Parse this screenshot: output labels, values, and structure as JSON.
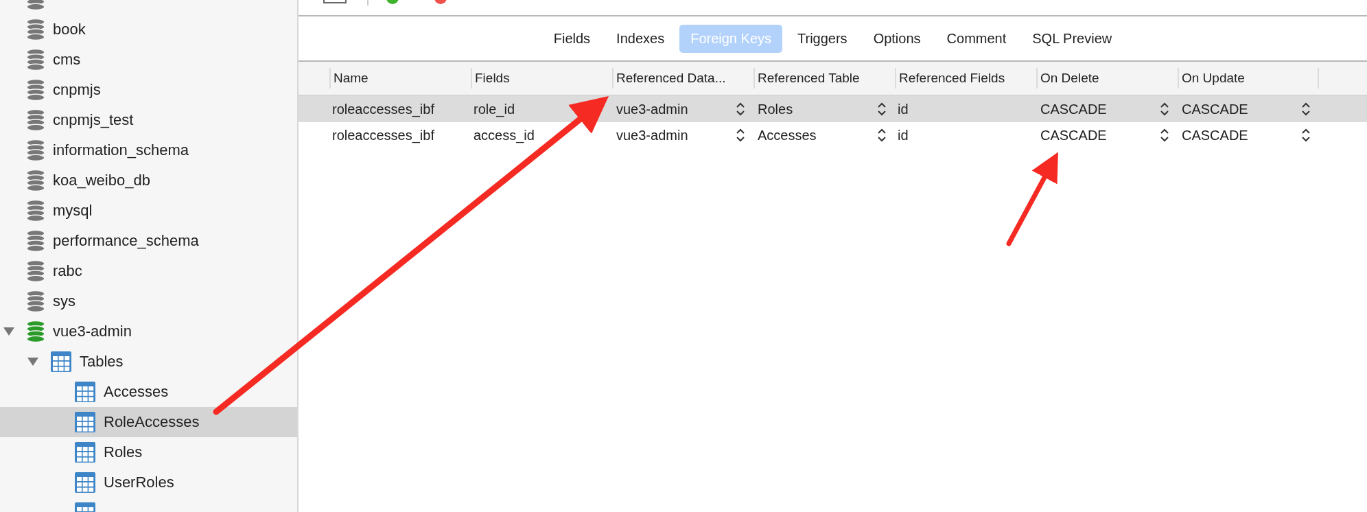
{
  "sidebar": {
    "items": [
      {
        "kind": "database",
        "active": false,
        "selected": false
      },
      {
        "label": "book",
        "kind": "database",
        "active": false,
        "selected": false
      },
      {
        "label": "cms",
        "kind": "database",
        "active": false,
        "selected": false
      },
      {
        "label": "cnpmjs",
        "kind": "database",
        "active": false,
        "selected": false
      },
      {
        "label": "cnpmjs_test",
        "kind": "database",
        "active": false,
        "selected": false
      },
      {
        "label": "information_schema",
        "kind": "database",
        "active": false,
        "selected": false
      },
      {
        "label": "koa_weibo_db",
        "kind": "database",
        "active": false,
        "selected": false
      },
      {
        "label": "mysql",
        "kind": "database",
        "active": false,
        "selected": false
      },
      {
        "label": "performance_schema",
        "kind": "database",
        "active": false,
        "selected": false
      },
      {
        "label": "rabc",
        "kind": "database",
        "active": false,
        "selected": false
      },
      {
        "label": "sys",
        "kind": "database",
        "active": false,
        "selected": false
      },
      {
        "label": "vue3-admin",
        "kind": "database",
        "active": true,
        "selected": false,
        "expanded": true,
        "children": [
          {
            "label": "Tables",
            "kind": "group",
            "selected": false,
            "expanded": true,
            "children": [
              {
                "label": "Accesses",
                "kind": "table",
                "selected": false
              },
              {
                "label": "RoleAccesses",
                "kind": "table",
                "selected": true
              },
              {
                "label": "Roles",
                "kind": "table",
                "selected": false
              },
              {
                "label": "UserRoles",
                "kind": "table",
                "selected": false
              },
              {
                "kind": "table",
                "selected": false
              }
            ]
          }
        ]
      }
    ]
  },
  "tabs": [
    {
      "label": "Fields",
      "selected": false
    },
    {
      "label": "Indexes",
      "selected": false
    },
    {
      "label": "Foreign Keys",
      "selected": true
    },
    {
      "label": "Triggers",
      "selected": false
    },
    {
      "label": "Options",
      "selected": false
    },
    {
      "label": "Comment",
      "selected": false
    },
    {
      "label": "SQL Preview",
      "selected": false
    }
  ],
  "table": {
    "columns": [
      {
        "label": "Name",
        "kind": "text"
      },
      {
        "label": "Fields",
        "kind": "text"
      },
      {
        "label": "Referenced Data...",
        "kind": "popup"
      },
      {
        "label": "Referenced Table",
        "kind": "popup"
      },
      {
        "label": "Referenced Fields",
        "kind": "text"
      },
      {
        "label": "On Delete",
        "kind": "popup"
      },
      {
        "label": "On Update",
        "kind": "popup"
      }
    ],
    "rows": [
      {
        "selected": true,
        "cells": [
          "roleaccesses_ibf",
          "role_id",
          "vue3-admin",
          "Roles",
          "id",
          "CASCADE",
          "CASCADE"
        ]
      },
      {
        "selected": false,
        "cells": [
          "roleaccesses_ibf",
          "access_id",
          "vue3-admin",
          "Accesses",
          "id",
          "CASCADE",
          "CASCADE"
        ]
      }
    ]
  }
}
